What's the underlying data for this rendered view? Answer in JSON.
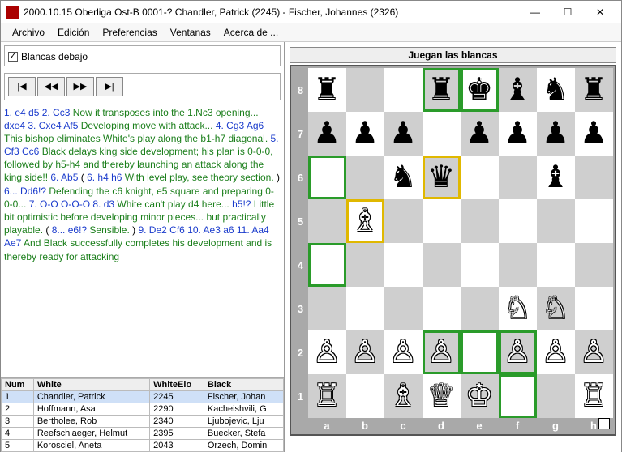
{
  "window": {
    "title": "2000.10.15 Oberliga Ost-B 0001-? Chandler, Patrick (2245) - Fischer, Johannes (2326)"
  },
  "menu": [
    "Archivo",
    "Edición",
    "Preferencias",
    "Ventanas",
    "Acerca de ..."
  ],
  "options": {
    "white_below": "Blancas debajo"
  },
  "nav": {
    "first": "|◀",
    "prev": "◀◀",
    "next": "▶▶",
    "last": "▶|"
  },
  "moves": [
    {
      "t": "mv",
      "v": "1. e4 d5 2. Cc3 "
    },
    {
      "t": "cm",
      "v": "Now it transposes into the 1.Nc3 opening... "
    },
    {
      "t": "mv",
      "v": "dxe4 3. Cxe4 Af5 "
    },
    {
      "t": "cm",
      "v": "Developing move with attack... "
    },
    {
      "t": "mv",
      "v": "4. Cg3 Ag6 "
    },
    {
      "t": "cm",
      "v": "This bishop eliminates White's play along the b1-h7 diagonal. "
    },
    {
      "t": "mv",
      "v": "5. Cf3 Cc6 "
    },
    {
      "t": "cm",
      "v": "Black delays king side development; his plan is 0-0-0, followed by h5-h4 and thereby launching an attack along the king side!! "
    },
    {
      "t": "mv",
      "v": "6. Ab5"
    },
    {
      "t": "tx",
      "v": "\n   ( "
    },
    {
      "t": "mv",
      "v": "6. h4 h6 "
    },
    {
      "t": "cm",
      "v": "With level play, see theory section."
    },
    {
      "t": "tx",
      "v": " )\n"
    },
    {
      "t": "mv",
      "v": "6... Dd6!? "
    },
    {
      "t": "cm",
      "v": "Defending the c6 knight, e5 square and preparing 0-0-0... "
    },
    {
      "t": "mv",
      "v": "7. O-O O-O-O 8. d3 "
    },
    {
      "t": "cm",
      "v": "White can't play d4 here... "
    },
    {
      "t": "mv",
      "v": "h5!? "
    },
    {
      "t": "cm",
      "v": "Little bit optimistic before developing minor pieces... but practically playable."
    },
    {
      "t": "tx",
      "v": "\n   ( "
    },
    {
      "t": "mv",
      "v": "8... e6!? "
    },
    {
      "t": "cm",
      "v": "Sensible."
    },
    {
      "t": "tx",
      "v": " ) "
    },
    {
      "t": "mv",
      "v": "9. De2 Cf6 10. Ae3 a6 11. Aa4 Ae7 "
    },
    {
      "t": "cm",
      "v": "And Black successfully completes his development and is thereby ready for attacking"
    }
  ],
  "table": {
    "headers": [
      "Num",
      "White",
      "WhiteElo",
      "Black"
    ],
    "rows": [
      [
        "1",
        "Chandler, Patrick",
        "2245",
        "Fischer, Johan"
      ],
      [
        "2",
        "Hoffmann, Asa",
        "2290",
        "Kacheishvili, G"
      ],
      [
        "3",
        "Bertholee, Rob",
        "2340",
        "Ljubojevic, Lju"
      ],
      [
        "4",
        "Reefschlaeger, Helmut",
        "2395",
        "Buecker, Stefa"
      ],
      [
        "5",
        "Korosciel, Aneta",
        "2043",
        "Orzech, Domin"
      ]
    ],
    "selected": 0
  },
  "board": {
    "title": "Juegan las blancas",
    "ranks": [
      "8",
      "7",
      "6",
      "5",
      "4",
      "3",
      "2",
      "1"
    ],
    "files": [
      "a",
      "b",
      "c",
      "d",
      "e",
      "f",
      "g",
      "h"
    ],
    "pieces": {
      "a8": "br",
      "d8": "br",
      "e8": "bk",
      "f8": "bb",
      "g8": "bn",
      "h8": "br",
      "a7": "bp",
      "b7": "bp",
      "c7": "bp",
      "e7": "bp",
      "f7": "bp",
      "g7": "bp",
      "h7": "bp",
      "c6": "bn",
      "d6": "bq",
      "g6": "bb",
      "b5": "wb",
      "f3": "wn",
      "g3": "wn",
      "a2": "wp",
      "b2": "wp",
      "c2": "wp",
      "d2": "wp",
      "f2": "wp",
      "g2": "wp",
      "h2": "wp",
      "a1": "wr",
      "c1": "wb",
      "d1": "wq",
      "e1": "wk",
      "h1": "wr"
    },
    "highlights": {
      "green": [
        "a6",
        "a4",
        "e8",
        "e2",
        "f2",
        "f1",
        "d8",
        "d2"
      ],
      "yellow": [
        "d6",
        "b5"
      ]
    }
  }
}
